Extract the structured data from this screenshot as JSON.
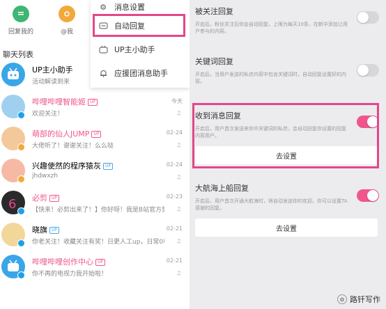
{
  "top_icons": [
    {
      "label": "回复我的",
      "icon": "reply-icon",
      "color": "#3fb673"
    },
    {
      "label": "@我",
      "icon": "at-icon",
      "color": "#f2a93b"
    }
  ],
  "section_title": "聊天列表",
  "menu": {
    "items": [
      {
        "label": "消息设置",
        "icon": "gear-icon"
      },
      {
        "label": "自动回复",
        "icon": "chat-bubble-icon"
      },
      {
        "label": "UP主小助手",
        "icon": "tv-icon"
      },
      {
        "label": "应援团消息助手",
        "icon": "bell-icon"
      }
    ]
  },
  "chats": [
    {
      "name": "UP主小助手",
      "preview": "活动解读到来",
      "date": "",
      "badge": "",
      "name_pink": false,
      "avatar_color": "#3aa6e8"
    },
    {
      "name": "哔哩哔哩智能姬",
      "preview": "欢迎关注！",
      "date": "今天",
      "badge": "UP",
      "name_pink": true,
      "avatar_color": "#9fd0f0"
    },
    {
      "name": "萌部的仙人JUMP",
      "preview": "大佬听了！谢谢关注！么么哒",
      "date": "02-24",
      "badge": "UP",
      "name_pink": true,
      "avatar_color": "#f3c99b"
    },
    {
      "name": "兴趣使然的程序猿灰",
      "preview": "jhdwxzh",
      "date": "02-24",
      "badge": "UP",
      "name_pink": false,
      "avatar_color": "#f6b9a4"
    },
    {
      "name": "必剪",
      "preview": "【快来！必剪出来了！】你好呀！我是B站官方剪辑A...",
      "date": "02-23",
      "badge": "UP",
      "name_pink": true,
      "avatar_color": "#2a2a2a"
    },
    {
      "name": "晓旗",
      "preview": "你老关注！收藏关注有奖！日更人工up，日常0收入...",
      "date": "02-21",
      "badge": "UP",
      "name_pink": false,
      "avatar_color": "#f1d89a"
    },
    {
      "name": "哔哩哔哩创作中心",
      "preview": "你不再的电视力我开始啦！",
      "date": "02-21",
      "badge": "UP",
      "name_pink": true,
      "avatar_color": "#3aa6e8"
    }
  ],
  "settings": [
    {
      "title": "被关注回复",
      "desc": "开启后，粉丝关注后你会自动回复，上限为每天10条，在新中添加让用户参与的内容。",
      "on": false,
      "button": ""
    },
    {
      "title": "关键词回复",
      "desc": "开启后，当用户发送的私信内容中包含关键词时，自动回复设置好的内容。",
      "on": false,
      "button": ""
    },
    {
      "title": "收到消息回复",
      "desc": "开启后，用户首次发送来你中关键词的私信，会自动回复你设置的回复内容用户。",
      "on": true,
      "button": "去设置"
    },
    {
      "title": "大航海上船回复",
      "desc": "开启后，用户首次开通大航海时，将自动发送你的欢迎，你可以设置TA感谢的回复。",
      "on": true,
      "button": "去设置"
    }
  ],
  "watermark": "路钎写作"
}
